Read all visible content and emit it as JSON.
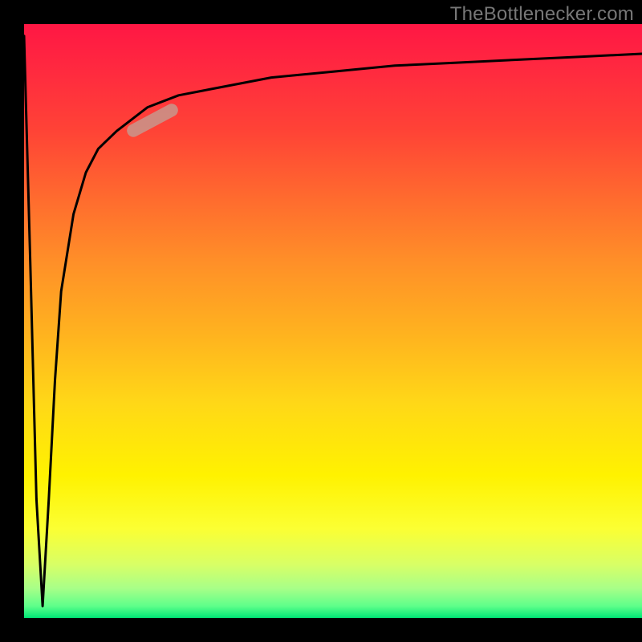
{
  "attribution": "TheBottlenecker.com",
  "colors": {
    "gradient_top": "#ff1744",
    "gradient_bottom": "#00e676",
    "frame": "#000000",
    "curve": "#000000",
    "segment": "rgba(200,150,140,0.85)",
    "attribution_text": "#777777"
  },
  "chart_data": {
    "type": "line",
    "title": "",
    "xlabel": "",
    "ylabel": "",
    "xlim": [
      0,
      100
    ],
    "ylim": [
      0,
      100
    ],
    "legend": false,
    "grid": false,
    "curve_description": "Sharp dip from top-left to bottom near x≈3, then rapid logarithmic-style rise approaching y≈95 by x≈100",
    "x": [
      0,
      1,
      2,
      3,
      4,
      5,
      6,
      8,
      10,
      12,
      15,
      20,
      25,
      30,
      40,
      50,
      60,
      70,
      80,
      90,
      100
    ],
    "values": [
      98,
      60,
      20,
      2,
      20,
      40,
      55,
      68,
      75,
      79,
      82,
      86,
      88,
      89,
      91,
      92,
      93,
      93.5,
      94,
      94.5,
      95
    ],
    "highlight_segment": {
      "x_range": [
        14,
        24
      ],
      "y_range": [
        82,
        87
      ],
      "note": "short highlighted band along curve"
    }
  }
}
